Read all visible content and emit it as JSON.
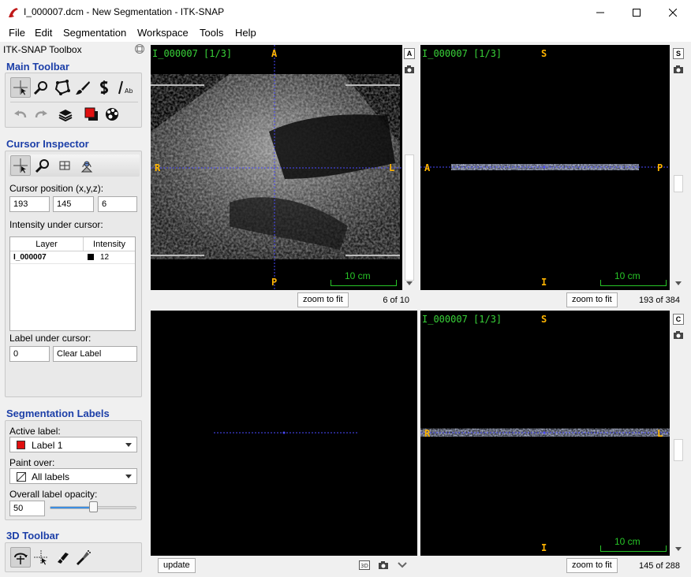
{
  "window": {
    "title": "I_000007.dcm - New Segmentation - ITK-SNAP",
    "minimize": "—",
    "maximize": "☐",
    "close": "✕"
  },
  "menu": [
    "File",
    "Edit",
    "Segmentation",
    "Workspace",
    "Tools",
    "Help"
  ],
  "toolbox": {
    "title": "ITK-SNAP Toolbox",
    "main_toolbar": {
      "title": "Main Toolbar",
      "tools": [
        "crosshair-icon",
        "zoom-icon",
        "polygon-icon",
        "paintbrush-icon",
        "snake-icon",
        "annotation-icon"
      ],
      "tools2": [
        "undo-icon",
        "redo-icon",
        "layers-icon",
        "label-color-icon",
        "palette-icon"
      ]
    },
    "cursor_inspector": {
      "title": "Cursor Inspector",
      "position_label": "Cursor position (x,y,z):",
      "x": "193",
      "y": "145",
      "z": "6",
      "intensity_label": "Intensity under cursor:",
      "table": {
        "headers": [
          "Layer",
          "Intensity"
        ],
        "rows": [
          {
            "layer": "I_000007",
            "intensity": "12"
          }
        ]
      },
      "label_under_cursor": "Label under cursor:",
      "label_id": "0",
      "label_name": "Clear Label"
    },
    "segmentation_labels": {
      "title": "Segmentation Labels",
      "active_label_caption": "Active label:",
      "active_label": "Label 1",
      "active_label_color": "#e01010",
      "paint_over_caption": "Paint over:",
      "paint_over": "All labels",
      "opacity_caption": "Overall label opacity:",
      "opacity_value": "50",
      "opacity_fraction": 0.5
    },
    "toolbar_3d": {
      "title": "3D Toolbar"
    }
  },
  "views": {
    "axial": {
      "label": "I_000007 [1/3]",
      "top": "A",
      "bottom": "P",
      "left": "R",
      "right": "L",
      "scale": "10 cm",
      "zoom": "zoom to fit",
      "slice": "6 of 10",
      "side_letter": "A"
    },
    "sagittal": {
      "label": "I_000007 [1/3]",
      "top": "S",
      "bottom": "I",
      "left": "A",
      "right": "P",
      "scale": "10 cm",
      "zoom": "zoom to fit",
      "slice": "193 of 384",
      "side_letter": "S"
    },
    "render3d": {
      "update": "update"
    },
    "coronal": {
      "label": "I_000007 [1/3]",
      "top": "S",
      "bottom": "I",
      "left": "R",
      "right": "L",
      "scale": "10 cm",
      "zoom": "zoom to fit",
      "slice": "145 of 288",
      "side_letter": "C"
    }
  },
  "colors": {
    "section_title": "#1c3fa8",
    "view_label": "#39d239",
    "orientation": "#ffb400",
    "crosshair": "#4a4aff"
  }
}
